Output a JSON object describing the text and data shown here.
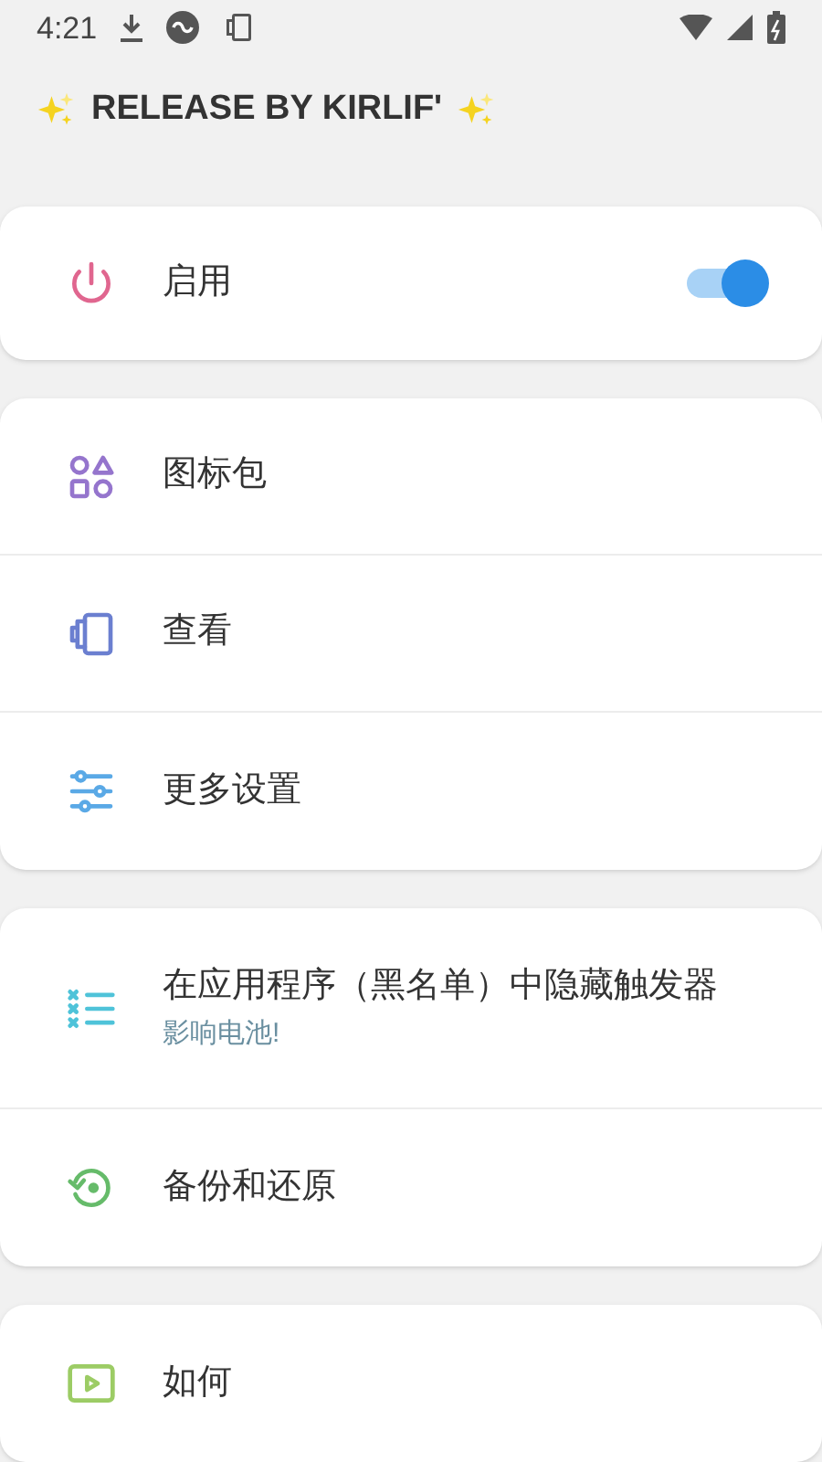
{
  "status_bar": {
    "time": "4:21"
  },
  "header": {
    "title": "RELEASE BY KIRLIF'"
  },
  "groups": [
    {
      "items": [
        {
          "kind": "power",
          "label": "启用",
          "on": true
        }
      ]
    },
    {
      "items": [
        {
          "kind": "shapes",
          "label": "图标包"
        },
        {
          "kind": "view",
          "label": "查看"
        },
        {
          "kind": "sliders",
          "label": "更多设置"
        }
      ]
    },
    {
      "items": [
        {
          "kind": "list-x",
          "label": "在应用程序（黑名单）中隐藏触发器",
          "subtitle": "影响电池!"
        },
        {
          "kind": "restore",
          "label": "备份和还原"
        }
      ]
    },
    {
      "items": [
        {
          "kind": "play",
          "label": "如何"
        }
      ]
    }
  ]
}
